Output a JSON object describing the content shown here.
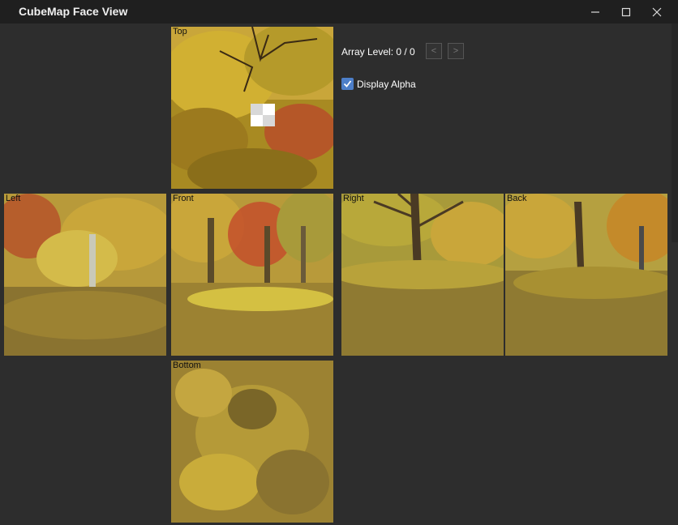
{
  "window": {
    "title": "CubeMap Face View"
  },
  "controls": {
    "array_level_label": "Array Level: 0 / 0",
    "prev_label": "<",
    "next_label": ">",
    "display_alpha_label": "Display Alpha",
    "display_alpha_checked": true
  },
  "faces": {
    "top": "Top",
    "left": "Left",
    "front": "Front",
    "right": "Right",
    "back": "Back",
    "bottom": "Bottom"
  },
  "colors": {
    "background": "#2d2d2d",
    "titlebar": "#1f1f1f",
    "checkbox_accent": "#4d7fc9",
    "foliage_gold": "#c9a22a",
    "ground_olive": "#8a7330"
  }
}
